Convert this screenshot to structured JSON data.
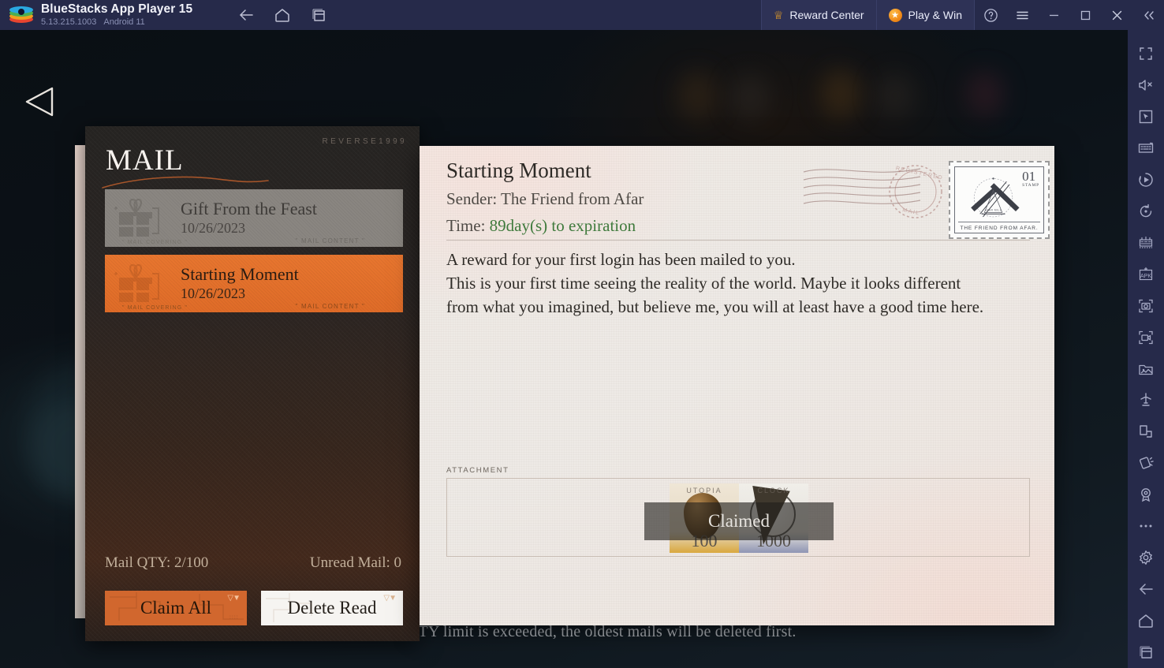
{
  "titlebar": {
    "app_title": "BlueStacks App Player 15",
    "version": "5.13.215.1003",
    "android": "Android 11",
    "nav": [
      {
        "name": "back-button",
        "icon": "arrow-left-icon"
      },
      {
        "name": "home-button",
        "icon": "home-icon"
      },
      {
        "name": "multi-instance-button",
        "icon": "windows-icon"
      }
    ],
    "reward_center": "Reward Center",
    "play_win": "Play & Win",
    "controls": [
      {
        "name": "help-button",
        "icon": "question-circle-icon"
      },
      {
        "name": "menu-button",
        "icon": "hamburger-icon"
      },
      {
        "name": "minimize-button",
        "icon": "minimize-icon"
      },
      {
        "name": "maximize-button",
        "icon": "maximize-icon"
      },
      {
        "name": "close-button",
        "icon": "close-icon"
      },
      {
        "name": "collapse-sidebar-button",
        "icon": "chevrons-left-icon"
      }
    ]
  },
  "sidebar": {
    "items": [
      {
        "name": "fullscreen-button",
        "icon": "fullscreen-icon"
      },
      {
        "name": "mute-button",
        "icon": "speaker-mute-icon"
      },
      {
        "name": "game-controls-button",
        "icon": "cursor-box-icon"
      },
      {
        "name": "keyboard-controls-button",
        "icon": "keyboard-icon"
      },
      {
        "name": "macro-recorder-button",
        "icon": "play-circle-icon"
      },
      {
        "name": "rotate-button",
        "icon": "rotate-icon"
      },
      {
        "name": "multi-instance-manager-button",
        "icon": "instance-manager-icon"
      },
      {
        "name": "install-apk-button",
        "icon": "apk-icon"
      },
      {
        "name": "screenshot-button",
        "icon": "camera-icon"
      },
      {
        "name": "record-screen-button",
        "icon": "video-camera-icon"
      },
      {
        "name": "media-manager-button",
        "icon": "image-folder-icon"
      },
      {
        "name": "eco-mode-button",
        "icon": "airplane-icon"
      },
      {
        "name": "trim-memory-button",
        "icon": "corner-shapes-icon"
      },
      {
        "name": "shake-button",
        "icon": "tilt-icon"
      },
      {
        "name": "location-button",
        "icon": "location-pin-icon"
      },
      {
        "name": "more-button",
        "icon": "ellipsis-icon"
      },
      {
        "name": "settings-button",
        "icon": "gear-icon"
      },
      {
        "name": "back-nav-button",
        "icon": "arrow-left-icon"
      },
      {
        "name": "home-nav-button",
        "icon": "home-icon"
      },
      {
        "name": "recents-nav-button",
        "icon": "windows-icon"
      }
    ]
  },
  "game": {
    "back_arrow": "back-triangle-icon",
    "hint": "When mail QTY limit is exceeded, the oldest mails will be deleted first."
  },
  "mail_panel": {
    "brandmark": "REVERSE1999",
    "title": "MAIL",
    "items": [
      {
        "subject": "Gift From the Feast",
        "date": "10/26/2023",
        "state": "read",
        "tag_left": "\" MAIL COVERING \"",
        "tag_right": "\" MAIL CONTENT \""
      },
      {
        "subject": "Starting Moment",
        "date": "10/26/2023",
        "state": "unread",
        "tag_left": "\" MAIL COVERING \"",
        "tag_right": "\" MAIL CONTENT \""
      }
    ],
    "stats": {
      "qty_label": "Mail QTY: 2/100",
      "unread_label": "Unread Mail: 0"
    },
    "buttons": {
      "claim_all": "Claim All",
      "delete_read": "Delete Read"
    }
  },
  "letter": {
    "title": "Starting Moment",
    "sender_label": "Sender:",
    "sender": "The Friend from Afar",
    "time_label": "Time:",
    "time_value": "89day(s) to expiration",
    "body_lines": [
      "A reward for your first login has been mailed to you.",
      "This is your first time seeing the reality of the world. Maybe it looks different",
      "from what you imagined, but believe me, you will at least have a good time here."
    ],
    "stamp": {
      "number": "01",
      "sub": "STAMP",
      "caption": "THE FRIEND FROM AFAR.",
      "registered_mark": "REGISTERED"
    },
    "attachment": {
      "label": "ATTACHMENT",
      "items": [
        {
          "name_overlay": "UTOPIA",
          "qty": "100"
        },
        {
          "name_overlay": "CLOCK",
          "qty": "1000"
        }
      ],
      "claimed_label": "Claimed"
    }
  },
  "colors": {
    "accent_orange": "#e8762f",
    "titlebar_bg": "#262a4a",
    "panel_dark": "#2a2523",
    "paper": "#efe9e4",
    "green_time": "#3f7a3c"
  }
}
